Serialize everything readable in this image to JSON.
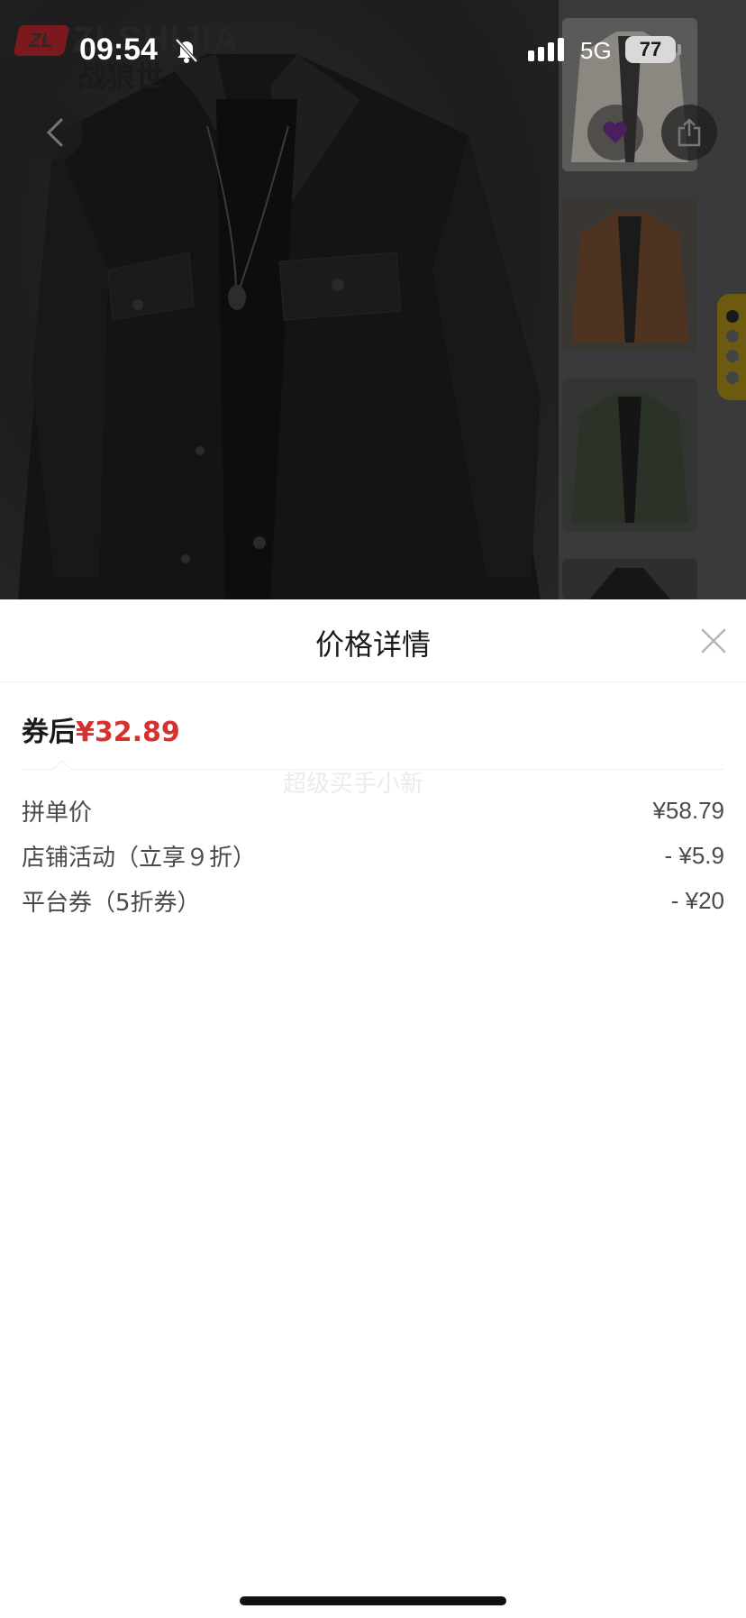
{
  "status_bar": {
    "time": "09:54",
    "network": "5G",
    "battery": "77"
  },
  "product": {
    "brand_word": "ZLSHIJIA",
    "brand_mark": "ZL",
    "brand_cn": "战狼世",
    "thumbnails": [
      "white-jacket",
      "brown-jacket",
      "olive-jacket",
      "black-jacket"
    ]
  },
  "sheet": {
    "title": "价格详情",
    "summary_label": "券后",
    "summary_price": "¥32.89",
    "watermark": "超级买手小新",
    "rows": [
      {
        "label": "拼单价",
        "value": "¥58.79"
      },
      {
        "label": "店铺活动（立享９折）",
        "value": "- ¥5.9"
      },
      {
        "label": "平台券（5折券）",
        "value": "- ¥20"
      }
    ]
  },
  "colors": {
    "accent_price": "#d4312f",
    "overlay": "#3a3a3a"
  }
}
